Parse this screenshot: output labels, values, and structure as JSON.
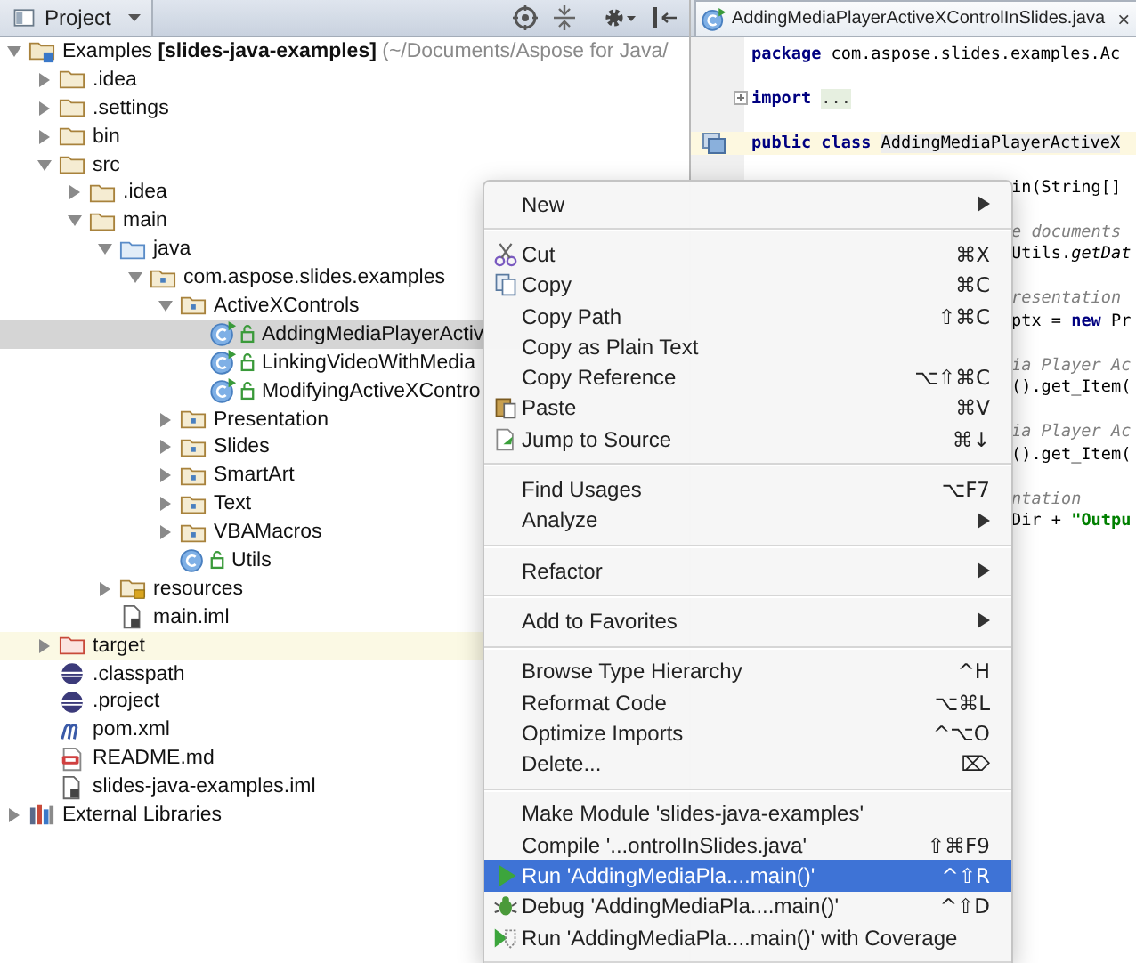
{
  "project_panel": {
    "view_selector": "Project",
    "tree": [
      {
        "kind": "module",
        "name": "Examples",
        "module": "[slides-java-examples]",
        "path": "(~/Documents/Aspose for Java/",
        "expanded": true,
        "selected": false,
        "children": [
          {
            "kind": "folder",
            "name": ".idea",
            "expanded": false,
            "selected": false
          },
          {
            "kind": "folder",
            "name": ".settings",
            "expanded": false,
            "selected": false
          },
          {
            "kind": "folder",
            "name": "bin",
            "expanded": false,
            "selected": false
          },
          {
            "kind": "folder",
            "name": "src",
            "expanded": true,
            "selected": false,
            "children": [
              {
                "kind": "folder",
                "name": ".idea",
                "expanded": false,
                "selected": false
              },
              {
                "kind": "folder",
                "name": "main",
                "expanded": true,
                "selected": false,
                "children": [
                  {
                    "kind": "source_root",
                    "name": "java",
                    "expanded": true,
                    "selected": false,
                    "children": [
                      {
                        "kind": "package",
                        "name": "com.aspose.slides.examples",
                        "expanded": true,
                        "selected": false,
                        "children": [
                          {
                            "kind": "package",
                            "name": "ActiveXControls",
                            "expanded": true,
                            "selected": false,
                            "children": [
                              {
                                "kind": "runnable_class",
                                "name": "AddingMediaPlayerActiv",
                                "selected": true
                              },
                              {
                                "kind": "runnable_class",
                                "name": "LinkingVideoWithMedia",
                                "selected": false
                              },
                              {
                                "kind": "runnable_class",
                                "name": "ModifyingActiveXContro",
                                "selected": false
                              }
                            ]
                          },
                          {
                            "kind": "package",
                            "name": "Presentation",
                            "expanded": false,
                            "selected": false
                          },
                          {
                            "kind": "package",
                            "name": "Slides",
                            "expanded": false,
                            "selected": false
                          },
                          {
                            "kind": "package",
                            "name": "SmartArt",
                            "expanded": false,
                            "selected": false
                          },
                          {
                            "kind": "package",
                            "name": "Text",
                            "expanded": false,
                            "selected": false
                          },
                          {
                            "kind": "package",
                            "name": "VBAMacros",
                            "expanded": false,
                            "selected": false
                          },
                          {
                            "kind": "class",
                            "name": "Utils",
                            "selected": false
                          }
                        ]
                      }
                    ]
                  },
                  {
                    "kind": "resources",
                    "name": "resources",
                    "expanded": false,
                    "selected": false
                  },
                  {
                    "kind": "module_file",
                    "name": "main.iml",
                    "selected": false
                  }
                ]
              }
            ]
          },
          {
            "kind": "excluded",
            "name": "target",
            "expanded": false,
            "selected": false
          },
          {
            "kind": "eclipse_file",
            "name": ".classpath",
            "selected": false
          },
          {
            "kind": "eclipse_file",
            "name": ".project",
            "selected": false
          },
          {
            "kind": "maven_file",
            "name": "pom.xml",
            "selected": false
          },
          {
            "kind": "markdown_file",
            "name": "README.md",
            "selected": false
          },
          {
            "kind": "module_file",
            "name": "slides-java-examples.iml",
            "selected": false
          }
        ]
      },
      {
        "kind": "libraries",
        "name": "External Libraries",
        "expanded": false,
        "selected": false
      }
    ]
  },
  "editor": {
    "tab": {
      "title": "AddingMediaPlayerActiveXControlInSlides.java",
      "close": "×"
    },
    "code_lines": [
      {
        "kind": "plain",
        "caret_line": false,
        "segments": [
          {
            "kind": "keyword",
            "text": "package"
          },
          {
            "kind": "plain",
            "text": " com.aspose.slides.examples.Ac"
          }
        ]
      },
      {
        "kind": "folded_import",
        "caret_line": false,
        "segments": [
          {
            "kind": "keyword",
            "text": "import"
          },
          {
            "kind": "folded",
            "text": "..."
          }
        ]
      },
      {
        "kind": "class_declaration",
        "caret_line": true,
        "segments": [
          {
            "kind": "keyword",
            "text": "public class"
          },
          {
            "kind": "identifier",
            "text": "AddingMediaPlayerActiveX"
          }
        ]
      }
    ],
    "code_fragments": [
      {
        "lines": [
          {
            "segments": [
              {
                "kind": "plain",
                "text": "in(String[]"
              }
            ]
          }
        ]
      },
      {
        "lines": [
          {
            "segments": [
              {
                "kind": "comment",
                "text": "e documents"
              }
            ]
          },
          {
            "segments": [
              {
                "kind": "plain",
                "text": "Utils."
              },
              {
                "kind": "static_call",
                "text": "getDat"
              }
            ]
          }
        ]
      },
      {
        "lines": [
          {
            "segments": [
              {
                "kind": "comment",
                "text": "resentation"
              }
            ]
          },
          {
            "segments": [
              {
                "kind": "plain",
                "text": "ptx = "
              },
              {
                "kind": "keyword",
                "text": "new"
              },
              {
                "kind": "plain",
                "text": " Pr"
              }
            ]
          }
        ]
      },
      {
        "lines": [
          {
            "segments": [
              {
                "kind": "comment",
                "text": "ia Player Ac"
              }
            ]
          },
          {
            "segments": [
              {
                "kind": "plain",
                "text": "().get_Item("
              }
            ]
          }
        ]
      },
      {
        "lines": [
          {
            "segments": [
              {
                "kind": "comment",
                "text": "ia Player Ac"
              }
            ]
          },
          {
            "segments": [
              {
                "kind": "plain",
                "text": "().get_Item("
              }
            ]
          }
        ]
      },
      {
        "lines": [
          {
            "segments": [
              {
                "kind": "comment",
                "text": "ntation"
              }
            ]
          },
          {
            "segments": [
              {
                "kind": "plain",
                "text": "Dir + "
              },
              {
                "kind": "string",
                "text": "\"Outpu"
              }
            ]
          }
        ]
      }
    ]
  },
  "context_menu": {
    "items": [
      {
        "kind": "plain",
        "label": "New",
        "submenu": true,
        "selected": false
      },
      {
        "kind": "separator"
      },
      {
        "kind": "cut",
        "label": "Cut",
        "shortcut": "⌘X",
        "submenu": false,
        "selected": false
      },
      {
        "kind": "copy",
        "label": "Copy",
        "shortcut": "⌘C",
        "submenu": false,
        "selected": false
      },
      {
        "kind": "plain",
        "label": "Copy Path",
        "shortcut": "⇧⌘C",
        "submenu": false,
        "selected": false
      },
      {
        "kind": "plain",
        "label": "Copy as Plain Text",
        "submenu": false,
        "selected": false
      },
      {
        "kind": "plain",
        "label": "Copy Reference",
        "shortcut": "⌥⇧⌘C",
        "submenu": false,
        "selected": false
      },
      {
        "kind": "paste",
        "label": "Paste",
        "shortcut": "⌘V",
        "submenu": false,
        "selected": false
      },
      {
        "kind": "jump",
        "label": "Jump to Source",
        "shortcut": "⌘↓",
        "submenu": false,
        "selected": false
      },
      {
        "kind": "separator"
      },
      {
        "kind": "plain",
        "label": "Find Usages",
        "shortcut": "⌥F7",
        "submenu": false,
        "selected": false
      },
      {
        "kind": "plain",
        "label": "Analyze",
        "submenu": true,
        "selected": false
      },
      {
        "kind": "separator"
      },
      {
        "kind": "plain",
        "label": "Refactor",
        "submenu": true,
        "selected": false
      },
      {
        "kind": "separator"
      },
      {
        "kind": "plain",
        "label": "Add to Favorites",
        "submenu": true,
        "selected": false
      },
      {
        "kind": "separator"
      },
      {
        "kind": "plain",
        "label": "Browse Type Hierarchy",
        "shortcut": "^H",
        "submenu": false,
        "selected": false
      },
      {
        "kind": "plain",
        "label": "Reformat Code",
        "shortcut": "⌥⌘L",
        "submenu": false,
        "selected": false
      },
      {
        "kind": "plain",
        "label": "Optimize Imports",
        "shortcut": "^⌥O",
        "submenu": false,
        "selected": false
      },
      {
        "kind": "plain",
        "label": "Delete...",
        "shortcut": "⌦",
        "submenu": false,
        "selected": false
      },
      {
        "kind": "separator"
      },
      {
        "kind": "plain",
        "label": "Make Module 'slides-java-examples'",
        "submenu": false,
        "selected": false
      },
      {
        "kind": "plain",
        "label": "Compile '...ontrolInSlides.java'",
        "shortcut": "⇧⌘F9",
        "submenu": false,
        "selected": false
      },
      {
        "kind": "run",
        "label": "Run 'AddingMediaPla....main()'",
        "shortcut": "^⇧R",
        "submenu": false,
        "selected": true
      },
      {
        "kind": "debug",
        "label": "Debug 'AddingMediaPla....main()'",
        "shortcut": "^⇧D",
        "submenu": false,
        "selected": false
      },
      {
        "kind": "coverage",
        "label": "Run 'AddingMediaPla....main()' with Coverage",
        "submenu": false,
        "selected": false
      },
      {
        "kind": "separator"
      }
    ]
  }
}
